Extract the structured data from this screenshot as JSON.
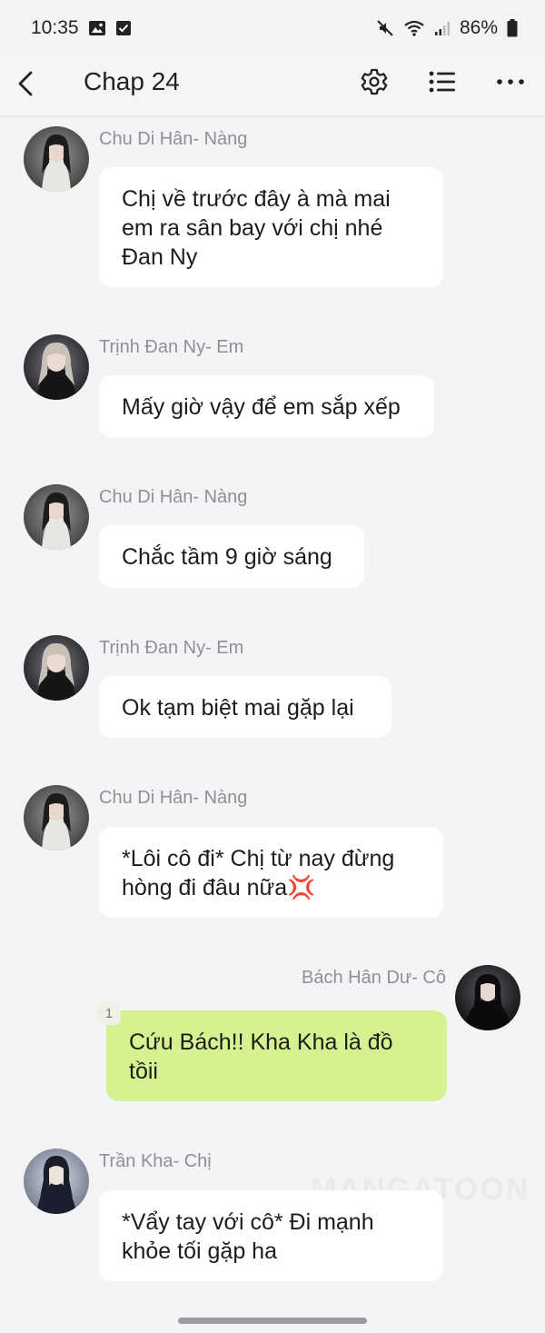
{
  "status": {
    "time": "10:35",
    "battery": "86%"
  },
  "header": {
    "title": "Chap 24"
  },
  "messages": [
    {
      "sender": "Chu Di Hân- Nàng",
      "text": "Chị về trước đây à mà mai em ra sân bay với chị nhé Đan Ny"
    },
    {
      "sender": "Trịnh Đan Ny- Em",
      "text": "Mấy giờ vậy để em sắp xếp"
    },
    {
      "sender": "Chu Di Hân- Nàng",
      "text": "Chắc tầm 9 giờ sáng"
    },
    {
      "sender": "Trịnh Đan Ny- Em",
      "text": "Ok tạm biệt mai gặp lại"
    },
    {
      "sender": "Chu Di Hân- Nàng",
      "text": "*Lôi cô đi* Chị từ nay đừng hòng đi đâu nữa💢"
    },
    {
      "sender": "Bách Hân Dư- Cô",
      "text": "Cứu Bách!! Kha Kha là đồ tồii",
      "badge": "1"
    },
    {
      "sender": "Trần Kha- Chị",
      "text": "*Vẩy tay với cô* Đi mạnh khỏe tối gặp ha"
    }
  ],
  "watermark": "MANGATOON",
  "colors": {
    "background": "#f3f4f6",
    "bubble": "#ffffff",
    "own_bubble": "#d5f290",
    "sender": "#8e9096"
  }
}
